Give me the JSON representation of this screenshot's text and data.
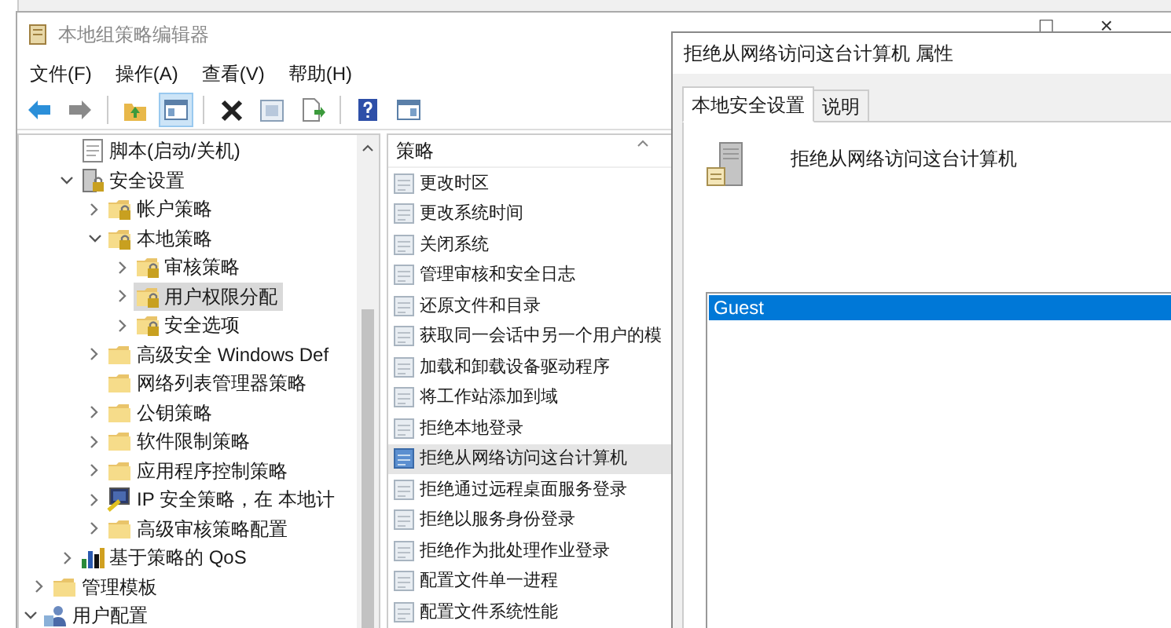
{
  "window": {
    "title": "本地组策略编辑器",
    "controls": [
      "□",
      "×"
    ]
  },
  "menu": [
    "文件(F)",
    "操作(A)",
    "查看(V)",
    "帮助(H)"
  ],
  "toolbar": [
    {
      "kind": "back",
      "pressed": false
    },
    {
      "kind": "forward",
      "pressed": false
    },
    {
      "kind": "sep"
    },
    {
      "kind": "up",
      "pressed": false
    },
    {
      "kind": "tree",
      "pressed": true
    },
    {
      "kind": "sep"
    },
    {
      "kind": "delete",
      "pressed": false
    },
    {
      "kind": "props",
      "pressed": false
    },
    {
      "kind": "export",
      "pressed": false
    },
    {
      "kind": "sep"
    },
    {
      "kind": "help",
      "pressed": false
    },
    {
      "kind": "view",
      "pressed": false
    }
  ],
  "tree": [
    {
      "children": [
        {
          "children": [
            {
              "label": "脚本(启动/关机)",
              "kind": "script",
              "selected": false
            },
            {
              "label": "安全设置",
              "kind": "security",
              "expanded": true,
              "selected": false,
              "children": [
                {
                  "label": "帐户策略",
                  "kind": "lockfolder",
                  "expanded": false,
                  "selected": false
                },
                {
                  "label": "本地策略",
                  "kind": "lockfolder",
                  "expanded": true,
                  "selected": false,
                  "children": [
                    {
                      "label": "审核策略",
                      "kind": "lockfolder",
                      "expanded": false,
                      "selected": false
                    },
                    {
                      "label": "用户权限分配",
                      "kind": "lockfolder",
                      "expanded": false,
                      "selected": true
                    },
                    {
                      "label": "安全选项",
                      "kind": "lockfolder",
                      "expanded": false,
                      "selected": false
                    }
                  ]
                },
                {
                  "label": "高级安全 Windows Def",
                  "kind": "folder",
                  "expanded": false,
                  "selected": false
                },
                {
                  "label": "网络列表管理器策略",
                  "kind": "folder",
                  "selected": false
                },
                {
                  "label": "公钥策略",
                  "kind": "folder",
                  "expanded": false,
                  "selected": false
                },
                {
                  "label": "软件限制策略",
                  "kind": "folder",
                  "expanded": false,
                  "selected": false
                },
                {
                  "label": "应用程序控制策略",
                  "kind": "folder",
                  "expanded": false,
                  "selected": false
                },
                {
                  "label": "IP 安全策略，在 本地计",
                  "kind": "ip",
                  "expanded": false,
                  "selected": false
                },
                {
                  "label": "高级审核策略配置",
                  "kind": "folder",
                  "expanded": false,
                  "selected": false
                }
              ]
            },
            {
              "label": "基于策略的 QoS",
              "kind": "qos",
              "expanded": false,
              "selected": false
            }
          ]
        },
        {
          "label": "管理模板",
          "kind": "folder",
          "expanded": false,
          "selected": false
        }
      ]
    },
    {
      "label": "用户配置",
      "kind": "user",
      "expanded": true,
      "selected": false
    }
  ],
  "policies": {
    "column": "策略",
    "rows": [
      {
        "label": "更改时区",
        "selected": false
      },
      {
        "label": "更改系统时间",
        "selected": false
      },
      {
        "label": "关闭系统",
        "selected": false
      },
      {
        "label": "管理审核和安全日志",
        "selected": false
      },
      {
        "label": "还原文件和目录",
        "selected": false
      },
      {
        "label": "获取同一会话中另一个用户的模",
        "selected": false
      },
      {
        "label": "加载和卸载设备驱动程序",
        "selected": false
      },
      {
        "label": "将工作站添加到域",
        "selected": false
      },
      {
        "label": "拒绝本地登录",
        "selected": false
      },
      {
        "label": "拒绝从网络访问这台计算机",
        "selected": true
      },
      {
        "label": "拒绝通过远程桌面服务登录",
        "selected": false
      },
      {
        "label": "拒绝以服务身份登录",
        "selected": false
      },
      {
        "label": "拒绝作为批处理作业登录",
        "selected": false
      },
      {
        "label": "配置文件单一进程",
        "selected": false
      },
      {
        "label": "配置文件系统性能",
        "selected": false
      }
    ]
  },
  "dialog": {
    "title": "拒绝从网络访问这台计算机 属性",
    "tabs": [
      {
        "label": "本地安全设置",
        "selected": true
      },
      {
        "label": "说明",
        "selected": false
      }
    ],
    "heading": "拒绝从网络访问这台计算机",
    "accounts": [
      {
        "label": "Guest",
        "selected": true
      }
    ]
  }
}
